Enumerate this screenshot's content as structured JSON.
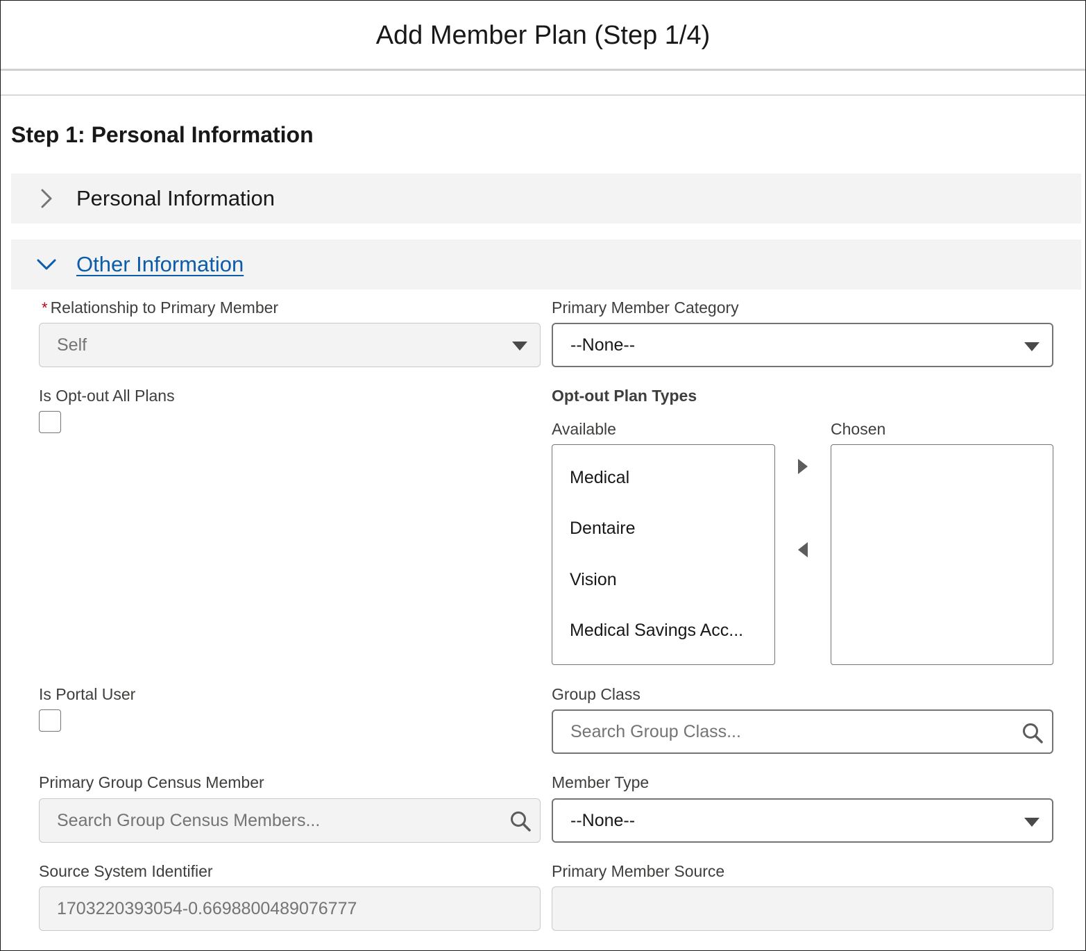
{
  "modal": {
    "title": "Add Member Plan (Step 1/4)"
  },
  "step": {
    "heading": "Step 1: Personal Information"
  },
  "sections": {
    "personal": {
      "label": "Personal Information",
      "icon": "chevron-right-icon",
      "expanded": false
    },
    "other": {
      "label": "Other Information",
      "icon": "chevron-down-icon",
      "expanded": true
    }
  },
  "fields": {
    "relationship": {
      "label": "Relationship to Primary Member",
      "required_mark": "*",
      "value": "Self"
    },
    "primary_category": {
      "label": "Primary Member Category",
      "value": "--None--"
    },
    "opt_out_all": {
      "label": "Is Opt-out All Plans",
      "checked": false
    },
    "opt_out_types": {
      "label": "Opt-out Plan Types",
      "available_label": "Available",
      "chosen_label": "Chosen",
      "available": [
        "Medical",
        "Dentaire",
        "Vision",
        "Medical Savings Acc..."
      ],
      "chosen": []
    },
    "portal_user": {
      "label": "Is Portal User",
      "checked": false
    },
    "group_class": {
      "label": "Group Class",
      "placeholder": "Search Group Class..."
    },
    "census_member": {
      "label": "Primary Group Census Member",
      "placeholder": "Search Group Census Members..."
    },
    "member_type": {
      "label": "Member Type",
      "value": "--None--"
    },
    "source_id": {
      "label": "Source System Identifier",
      "value": "1703220393054-0.6698800489076777"
    },
    "primary_source": {
      "label": "Primary Member Source",
      "value": ""
    }
  },
  "colors": {
    "link": "#0b5cab",
    "required": "#ba0517",
    "section_bg": "#f3f3f3",
    "border": "#747474"
  }
}
